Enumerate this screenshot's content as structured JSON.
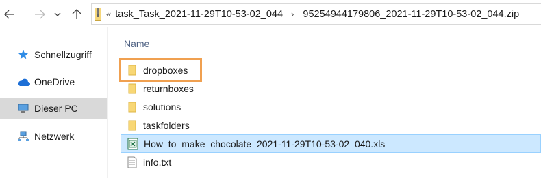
{
  "breadcrumb": {
    "overflow": "«",
    "segments": [
      "task_Task_2021-11-29T10-53-02_044",
      "95254944179806_2021-11-29T10-53-02_044.zip"
    ],
    "separator": "›"
  },
  "sidebar": {
    "items": [
      {
        "label": "Schnellzugriff",
        "icon": "star-icon"
      },
      {
        "label": "OneDrive",
        "icon": "cloud-icon"
      },
      {
        "label": "Dieser PC",
        "icon": "computer-icon",
        "selected": true
      },
      {
        "label": "Netzwerk",
        "icon": "network-icon"
      }
    ]
  },
  "content": {
    "column_name": "Name",
    "files": [
      {
        "name": "dropboxes",
        "type": "folder",
        "highlighted": true
      },
      {
        "name": "returnboxes",
        "type": "folder"
      },
      {
        "name": "solutions",
        "type": "folder"
      },
      {
        "name": "taskfolders",
        "type": "folder"
      },
      {
        "name": "How_to_make_chocolate_2021-11-29T10-53-02_040.xls",
        "type": "excel-file",
        "selected": true
      },
      {
        "name": "info.txt",
        "type": "text-file"
      }
    ]
  },
  "colors": {
    "accent_highlight": "#f0a050",
    "selection_bg": "#cce8ff",
    "folder": "#f8d775"
  }
}
